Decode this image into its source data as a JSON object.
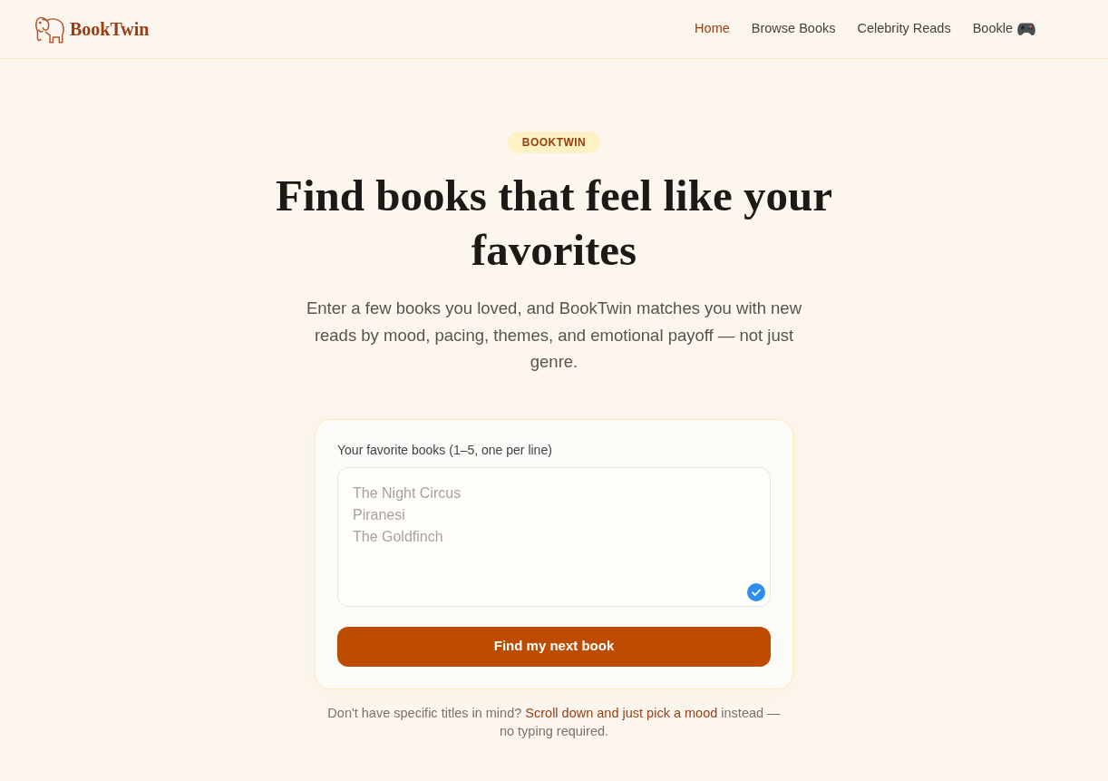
{
  "header": {
    "logo_text": "BookTwin",
    "nav": [
      {
        "label": "Home",
        "selected": true,
        "kind": "link"
      },
      {
        "label": "Browse Books",
        "selected": false,
        "kind": "link"
      },
      {
        "label": "Celebrity Reads",
        "selected": false,
        "kind": "link"
      },
      {
        "label": "Bookle",
        "selected": false,
        "kind": "game"
      }
    ]
  },
  "hero": {
    "badge": "BOOKTWIN",
    "title": "Find books that feel like your favorites",
    "subtitle": "Enter a few books you loved, and BookTwin matches you with new reads by mood, pacing, themes, and emotional payoff — not just genre."
  },
  "form": {
    "label": "Your favorite books (1–5, one per line)",
    "placeholder": "The Night Circus\nPiranesi\nThe Goldfinch",
    "checked": true,
    "button": "Find my next book"
  },
  "helper": {
    "text_before": "Don't have specific titles in mind?",
    "link": "Scroll down and just pick a mood",
    "text_after": "instead — no typing required."
  }
}
